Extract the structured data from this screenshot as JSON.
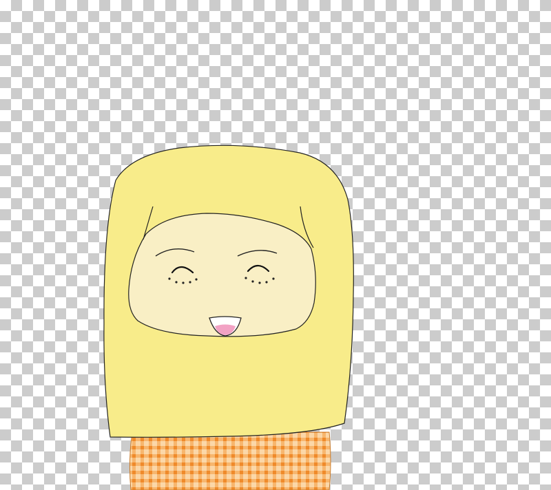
{
  "image": {
    "subject": "cartoon-girl-in-yellow-hijab",
    "background": "transparency-checkerboard"
  },
  "colors": {
    "checker_light": "#ffffff",
    "checker_dark": "#cccccc",
    "hijab": "#f8ec8a",
    "outline": "#222222",
    "face": "#f9efc5",
    "mouth": "#ffffff",
    "tongue": "#f2a2c4",
    "gingham_base": "#fbd7a8",
    "gingham_stripe": "#f39a3e"
  },
  "icons": {
    "left_eye": "closed-happy-eye-icon",
    "right_eye": "closed-happy-eye-icon"
  }
}
